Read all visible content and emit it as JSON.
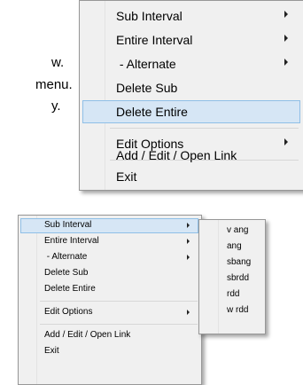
{
  "background_text": [
    "w.",
    "menu.",
    "y."
  ],
  "large_menu": {
    "items": [
      {
        "label": "Sub Interval",
        "submenu": true
      },
      {
        "label": "Entire Interval",
        "submenu": true
      },
      {
        "label": " - Alternate",
        "submenu": true
      },
      {
        "label": "Delete Sub",
        "submenu": false
      },
      {
        "label": "Delete Entire",
        "submenu": false,
        "highlighted": true
      },
      {
        "label": "Edit Options",
        "submenu": true
      },
      {
        "label": "Add / Edit / Open Link",
        "submenu": false
      },
      {
        "label": "Exit",
        "submenu": false
      }
    ]
  },
  "small_menu": {
    "items": [
      {
        "label": "Sub Interval",
        "submenu": true,
        "highlighted": true
      },
      {
        "label": "Entire Interval",
        "submenu": true
      },
      {
        "label": " - Alternate",
        "submenu": true
      },
      {
        "label": "Delete Sub",
        "submenu": false
      },
      {
        "label": "Delete Entire",
        "submenu": false
      },
      {
        "label": "Edit Options",
        "submenu": true
      },
      {
        "label": "Add / Edit / Open Link",
        "submenu": false
      },
      {
        "label": "Exit",
        "submenu": false
      }
    ]
  },
  "submenu": {
    "items": [
      "v ang",
      "ang",
      "sbang",
      "sbrdd",
      "rdd",
      "w rdd"
    ]
  },
  "colors": {
    "menu_bg": "#f0f0f0",
    "highlight_bg": "#d6e6f5",
    "highlight_border": "#8fbfe7"
  }
}
